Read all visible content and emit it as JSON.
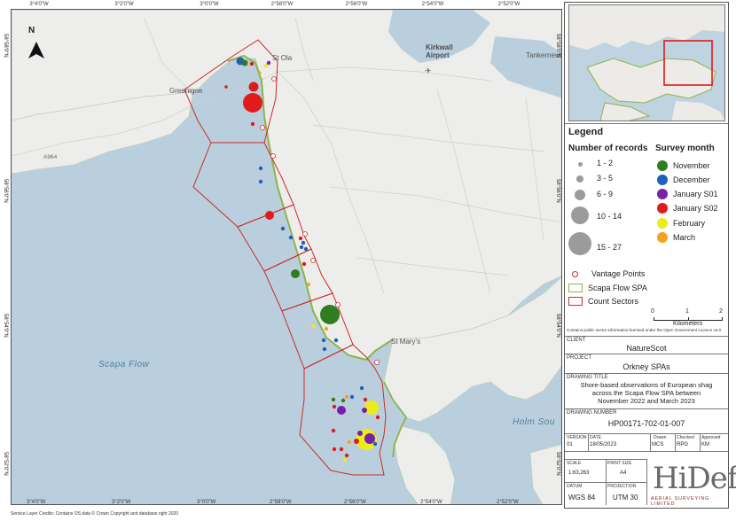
{
  "map": {
    "place_labels": {
      "kirkwall_airport": "Kirkwall\nAirport",
      "tankerness": "Tankerness",
      "st_ola": "St Ola",
      "greenigoe": "Greenigoe",
      "st_marys": "St Mary's"
    },
    "road_labels": {
      "a964": "A964"
    },
    "water_labels": {
      "scapa_flow": "Scapa Flow",
      "holm_sound": "Holm Sou"
    },
    "top_coords": [
      "3°4'0\"W",
      "3°2'0\"W",
      "3°0'0\"W",
      "2°58'0\"W",
      "2°56'0\"W",
      "2°54'0\"W",
      "2°52'0\"W"
    ],
    "bottom_coords": [
      "3°4'0\"W",
      "3°2'0\"W",
      "3°0'0\"W",
      "2°58'0\"W",
      "2°56'0\"W",
      "2°54'0\"W",
      "2°52'0\"W"
    ],
    "left_coords": [
      "58°58'0\"N",
      "58°56'0\"N",
      "58°54'0\"N",
      "58°52'0\"N"
    ],
    "right_coords": [
      "58°58'0\"N",
      "58°56'0\"N",
      "58°54'0\"N",
      "58°52'0\"N"
    ],
    "north_arrow_label": "N",
    "colors": {
      "sea": "#b9cfde",
      "land": "#ededeb",
      "count_sector": "#cc2a2a",
      "spa_boundary": "#8fb34a"
    },
    "observations": [
      {
        "month": "December",
        "count_class": "6 - 9"
      },
      {
        "month": "January S01",
        "count_class": "1 - 2"
      },
      {
        "month": "February",
        "count_class": "1 - 2"
      },
      {
        "month": "January S02",
        "count_class": "15 - 27"
      },
      {
        "month": "November",
        "count_class": "15 - 27"
      },
      {
        "month": "February",
        "count_class": "15 - 27"
      },
      {
        "month": "January S01",
        "count_class": "10 - 14"
      }
    ]
  },
  "legend": {
    "title": "Legend",
    "records_heading": "Number of records",
    "month_heading": "Survey month",
    "size_classes": [
      "1 - 2",
      "3 - 5",
      "6 - 9",
      "10 - 14",
      "15 - 27"
    ],
    "months": [
      {
        "label": "November",
        "color": "#2e7d1e"
      },
      {
        "label": "December",
        "color": "#1f5fbf"
      },
      {
        "label": "January S01",
        "color": "#7a1fa8"
      },
      {
        "label": "January S02",
        "color": "#e01b1b"
      },
      {
        "label": "February",
        "color": "#ecec1c"
      },
      {
        "label": "March",
        "color": "#f5a21c"
      }
    ],
    "vantage_points": "Vantage Points",
    "scapa_flow_spa": "Scapa Flow SPA",
    "count_sectors": "Count Sectors",
    "scale_ticks": [
      "0",
      "1",
      "2"
    ],
    "scale_unit": "Kilometers",
    "credit": "Contains public sector information licensed under the Open Government Licence v3.0"
  },
  "title_block": {
    "client_caption": "CLIENT",
    "client": "NatureScot",
    "project_caption": "PROJECT",
    "project": "Orkney SPAs",
    "drawing_title_caption": "DRAWING TITLE",
    "drawing_title_1": "Shore-based observations of European shag",
    "drawing_title_2": "across the Scapa Flow SPA between",
    "drawing_title_3": "November 2022 and March 2023",
    "drawing_number_caption": "DRAWING NUMBER",
    "drawing_number": "HP00171-702-01-007",
    "version_caption": "VERSION",
    "version": "01",
    "date_caption": "DATE",
    "date": "18/05/2023",
    "drawn_caption": "Drawn",
    "drawn": "MCS",
    "checked_caption": "Checked",
    "checked": "RPG",
    "approved_caption": "Approved",
    "approved": "KM",
    "scale_caption": "SCALE",
    "scale": "1:63,263",
    "print_size_caption": "PRINT SIZE",
    "print_size": "A4",
    "datum_caption": "DATUM",
    "datum": "WGS 84",
    "projection_caption": "PROJECTION",
    "projection": "UTM 30",
    "logo_text": "HiDef",
    "logo_sub": "AERIAL SURVEYING LIMITED"
  },
  "footer": {
    "credit": "Service Layer Credits: Contains OS data © Crown Copyright and database right 2020"
  }
}
